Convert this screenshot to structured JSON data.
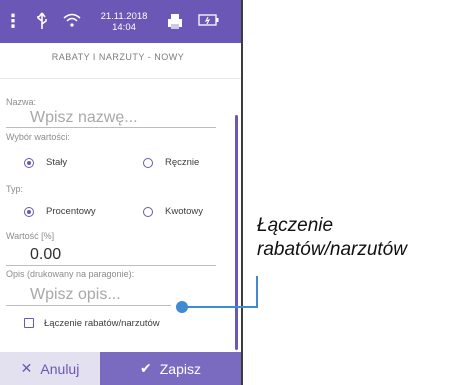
{
  "statusbar": {
    "date": "21.11.2018",
    "time": "14:04",
    "icons": [
      "kebab-menu-icon",
      "usb-icon",
      "wifi-icon",
      "printer-icon",
      "battery-icon"
    ]
  },
  "title": "RABATY I NARZUTY - NOWY",
  "form": {
    "name": {
      "label": "Nazwa:",
      "placeholder": "Wpisz nazwę..."
    },
    "value_choice": {
      "label": "Wybór wartości:",
      "options": [
        {
          "label": "Stały",
          "selected": true
        },
        {
          "label": "Ręcznie",
          "selected": false
        }
      ]
    },
    "type": {
      "label": "Typ:",
      "options": [
        {
          "label": "Procentowy",
          "selected": true
        },
        {
          "label": "Kwotowy",
          "selected": false
        }
      ]
    },
    "amount": {
      "label": "Wartość [%]",
      "value": "0.00"
    },
    "description": {
      "label": "Opis (drukowany na paragonie):",
      "placeholder": "Wpisz opis..."
    },
    "combine": {
      "label": "Łączenie rabatów/narzutów",
      "checked": false
    }
  },
  "buttons": {
    "cancel": "Anuluj",
    "save": "Zapisz"
  },
  "callout": {
    "line1": "Łączenie",
    "line2": "rabatów/narzutów"
  },
  "colors": {
    "accent": "#6b57b5",
    "save_button": "#7b6bc0",
    "cancel_button": "#e3e0ef",
    "callout": "#3f8ad1"
  }
}
